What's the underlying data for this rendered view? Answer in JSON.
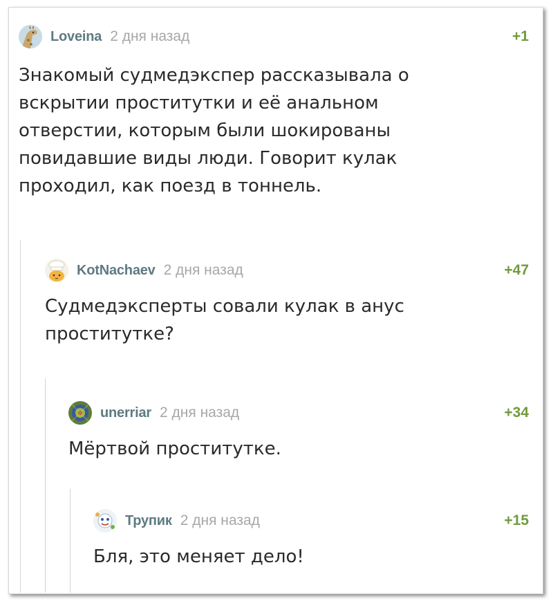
{
  "comments": [
    {
      "author": "Loveina",
      "time": "2 дня назад",
      "score": "+1",
      "avatar": "giraffe-avatar",
      "lines": [
        "Знакомый судмедэкспер рассказывала о",
        "вскрытии проститутки и её анальном",
        "отверстии, которым были шокированы",
        "повидавшие виды люди. Говорит кулак",
        "проходил, как поезд в тоннель."
      ]
    },
    {
      "author": "KotNachaev",
      "time": "2 дня назад",
      "score": "+47",
      "avatar": "chef-cat-avatar",
      "lines": [
        "Судмедэксперты совали кулак в анус",
        "проститутке?"
      ]
    },
    {
      "author": "unerriar",
      "time": "2 дня назад",
      "score": "+34",
      "avatar": "pattern-avatar",
      "lines": [
        "Мёртвой проститутке."
      ]
    },
    {
      "author": "Trynuk",
      "author_display": "Трупик",
      "time": "2 дня назад",
      "score": "+15",
      "avatar": "cartoon-avatar",
      "lines": [
        "Бля, это меняет дело!"
      ]
    }
  ],
  "colors": {
    "username": "#5d7a82",
    "time": "#a7a7a7",
    "score": "#6e9b3d",
    "text": "#2a2a2a",
    "thread_line": "#d4d4d4"
  }
}
